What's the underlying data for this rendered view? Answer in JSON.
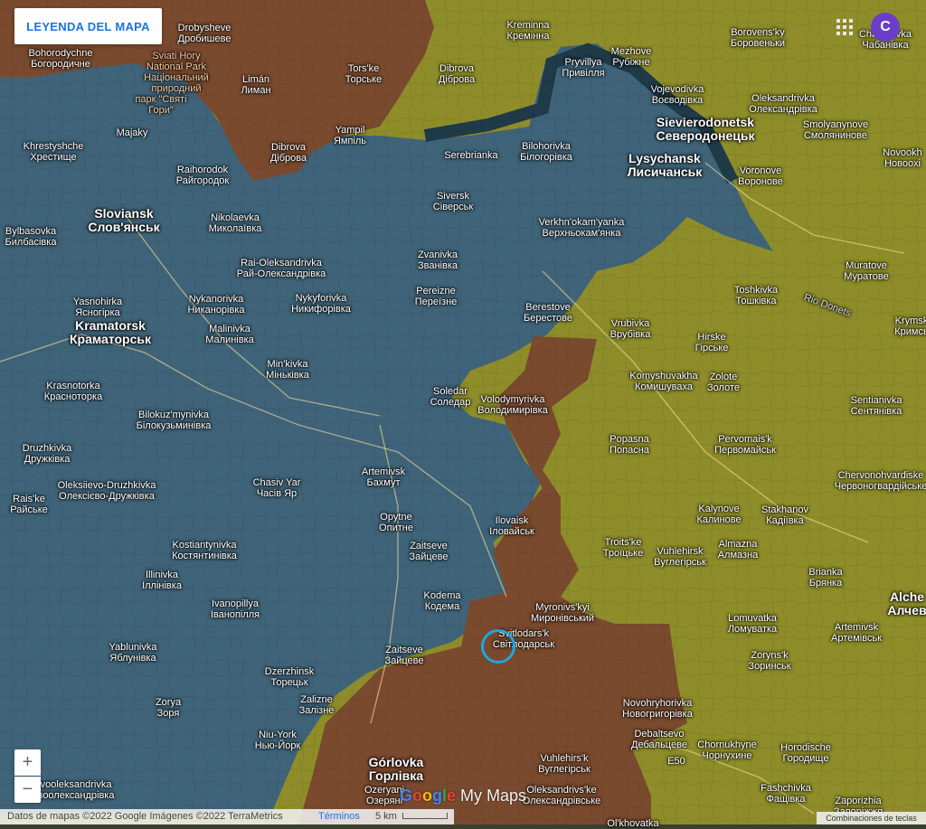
{
  "legend_button": {
    "label": "LEYENDA DEL MAPA"
  },
  "account": {
    "avatar_letter": "C"
  },
  "apps_icon": "apps-grid-icon",
  "zoom": {
    "in_label": "+",
    "out_label": "−"
  },
  "attribution": {
    "text": "Datos de mapas ©2022 Google Imágenes ©2022 TerraMetrics",
    "terms": "Términos",
    "scale": "5 km"
  },
  "shortcuts_label": "Combinaciones de teclas",
  "brand": {
    "g1": "G",
    "g2": "o",
    "g3": "o",
    "g4": "g",
    "g5": "l",
    "g6": "e",
    "mymaps": " My Maps"
  },
  "colors": {
    "ukraine_controlled": "#3f6378",
    "russia_advance": "#7a4a2e",
    "russia_controlled": "#8e8d2a",
    "marker": "#1ea7e1",
    "legend_text": "#1a73e8"
  },
  "places": [
    {
      "l1": "Bohorodychne",
      "l2": "Богородичне"
    },
    {
      "l1": "Drobysheve",
      "l2": "Дробишеве"
    },
    {
      "l1": "Sviati Hory",
      "l2": "National Park"
    },
    {
      "l1": "Національний",
      "l2": "природний"
    },
    {
      "l1": "парк \"Святі",
      "l2": "Гори\""
    },
    {
      "l1": "Limán",
      "l2": "Лиман"
    },
    {
      "l1": "Tors'ke",
      "l2": "Торське"
    },
    {
      "l1": "Kreminna",
      "l2": "Кремінна"
    },
    {
      "l1": "Dibrova",
      "l2": "Діброва"
    },
    {
      "l1": "Mezhove",
      "l2": "Рубіжне"
    },
    {
      "l1": "Pryvillya",
      "l2": "Привілля"
    },
    {
      "l1": "Borovens'ky",
      "l2": "Боровеньки"
    },
    {
      "l1": "Chabanivka",
      "l2": "Чабанівка"
    },
    {
      "l1": "Majaky",
      "l2": ""
    },
    {
      "l1": "Yampil",
      "l2": "Ямпіль"
    },
    {
      "l1": "Vojevodivka",
      "l2": "Воєводівка"
    },
    {
      "l1": "Oleksandrivka",
      "l2": "Олександрівка"
    },
    {
      "l1": "Sievierodonetsk",
      "l2": "Северодонецьк"
    },
    {
      "l1": "Smolyanynove",
      "l2": "Смолянинове"
    },
    {
      "l1": "Khrestyshche",
      "l2": "Хрестище"
    },
    {
      "l1": "Dibrova",
      "l2": "Діброва"
    },
    {
      "l1": "Serebrianka",
      "l2": ""
    },
    {
      "l1": "Bilohorivka",
      "l2": "Білогорівка"
    },
    {
      "l1": "Lysychansk",
      "l2": "Лисичанськ"
    },
    {
      "l1": "Novookh",
      "l2": "Новоохі"
    },
    {
      "l1": "Raihorodok",
      "l2": "Райгородок"
    },
    {
      "l1": "Voronove",
      "l2": "Воронове"
    },
    {
      "l1": "Siversk",
      "l2": "Сіверськ"
    },
    {
      "l1": "Sloviansk",
      "l2": "Слов'янськ"
    },
    {
      "l1": "Nikolaevka",
      "l2": "Миколаївка"
    },
    {
      "l1": "Verkhn'okam'yanka",
      "l2": "Верхньокам'янка"
    },
    {
      "l1": "Bylbasovka",
      "l2": "Билбасівка"
    },
    {
      "l1": "Zvanivka",
      "l2": "Званівка"
    },
    {
      "l1": "Rai-Oleksandrivka",
      "l2": "Рай-Олександрівка"
    },
    {
      "l1": "Muratove",
      "l2": "Муратове"
    },
    {
      "l1": "Toshkivka",
      "l2": "Тошківка"
    },
    {
      "l1": "Nykyforivka",
      "l2": "Никифорівка"
    },
    {
      "l1": "Pereizne",
      "l2": "Переїзне"
    },
    {
      "l1": "Yasnohirka",
      "l2": "Ясногірка"
    },
    {
      "l1": "Nykanorivka",
      "l2": "Никанорівка"
    },
    {
      "l1": "Berestove",
      "l2": "Берестове"
    },
    {
      "l1": "Krymsk",
      "l2": "Кримсь"
    },
    {
      "l1": "Kramatorsk",
      "l2": "Краматорськ"
    },
    {
      "l1": "Malinivka",
      "l2": "Малинівка"
    },
    {
      "l1": "Vrubivka",
      "l2": "Врубівка"
    },
    {
      "l1": "Hirske",
      "l2": "Гірське"
    },
    {
      "l1": "Min'kivka",
      "l2": "Міньківка"
    },
    {
      "l1": "Komyshuvakha",
      "l2": "Комишуваха"
    },
    {
      "l1": "Zolote",
      "l2": "Золоте"
    },
    {
      "l1": "Krasnotorka",
      "l2": "Красноторка"
    },
    {
      "l1": "Soledar",
      "l2": "Соледар"
    },
    {
      "l1": "Volodymyrivka",
      "l2": "Володимирівка"
    },
    {
      "l1": "Sentianivka",
      "l2": "Сентянівка"
    },
    {
      "l1": "Bilokuz'mynivka",
      "l2": "Білокузьминівка"
    },
    {
      "l1": "Druzhkivka",
      "l2": "Дружківка"
    },
    {
      "l1": "Popasna",
      "l2": "Попасна"
    },
    {
      "l1": "Pervomais'k",
      "l2": "Первомайськ"
    },
    {
      "l1": "Artemivsk",
      "l2": "Бахмут"
    },
    {
      "l1": "Chervonohvardiske",
      "l2": "Червоногвардійське"
    },
    {
      "l1": "Oleksiievo-Druzhkivka",
      "l2": "Олексієво-Дружківка"
    },
    {
      "l1": "Chasiv Yar",
      "l2": "Часів Яр"
    },
    {
      "l1": "Rais'ke",
      "l2": "Райське"
    },
    {
      "l1": "Stakhanov",
      "l2": "Кадіївка"
    },
    {
      "l1": "Kalynove",
      "l2": "Калинове"
    },
    {
      "l1": "Opytne",
      "l2": "Опитне"
    },
    {
      "l1": "Ilovaisk",
      "l2": "Іловайськ"
    },
    {
      "l1": "Troits'ke",
      "l2": "Троїцьке"
    },
    {
      "l1": "Vuhlehirsk",
      "l2": "Вуглегірськ"
    },
    {
      "l1": "Almazna",
      "l2": "Алмазна"
    },
    {
      "l1": "Kostiantynivka",
      "l2": "Костянтинівка"
    },
    {
      "l1": "Zaitseve",
      "l2": "Зайцеве"
    },
    {
      "l1": "Illinivka",
      "l2": "Іллінівка"
    },
    {
      "l1": "Brianka",
      "l2": "Брянка"
    },
    {
      "l1": "Kodema",
      "l2": "Кодема"
    },
    {
      "l1": "Alche",
      "l2": "Алчев"
    },
    {
      "l1": "Myronivs'kyi",
      "l2": "Миронівський"
    },
    {
      "l1": "Ivanopillya",
      "l2": "Іванопілля"
    },
    {
      "l1": "Lomuvatka",
      "l2": "Ломуватка"
    },
    {
      "l1": "Svitlodars'k",
      "l2": "Світлодарськ"
    },
    {
      "l1": "Artemivsk",
      "l2": "Артемівськ"
    },
    {
      "l1": "Yablunivka",
      "l2": "Яблунівка"
    },
    {
      "l1": "Zaitseve",
      "l2": "Зайцеве"
    },
    {
      "l1": "Zoryns'k",
      "l2": "Зоринськ"
    },
    {
      "l1": "Dzerzhinsk",
      "l2": "Торецьк"
    },
    {
      "l1": "Zorya",
      "l2": "Зоря"
    },
    {
      "l1": "Zalizne",
      "l2": "Залізне"
    },
    {
      "l1": "Novohryhorivka",
      "l2": "Новогригорівка"
    },
    {
      "l1": "Debaltsevo",
      "l2": "Дебальцеве"
    },
    {
      "l1": "Chornukhyne",
      "l2": "Чорнухине"
    },
    {
      "l1": "Niu-York",
      "l2": "Нью-Йорк"
    },
    {
      "l1": "Horodische",
      "l2": "Городище"
    },
    {
      "l1": "Górlovka",
      "l2": "Горлівка"
    },
    {
      "l1": "Vuhlehirs'k",
      "l2": "Вуглегірськ"
    },
    {
      "l1": "Novooleksandrivka",
      "l2": "Новоолександрівка"
    },
    {
      "l1": "Fashchivka",
      "l2": "Фащівка"
    },
    {
      "l1": "Oleksandrivs'ke",
      "l2": "Олександрівське"
    },
    {
      "l1": "Zaporizhia",
      "l2": "Запоріжжя"
    },
    {
      "l1": "Ozeryani",
      "l2": "Озеряні"
    },
    {
      "l1": "Ol'khovatka",
      "l2": ""
    },
    {
      "l1": "Rio Donets",
      "l2": ""
    },
    {
      "l1": "E50",
      "l2": ""
    }
  ]
}
